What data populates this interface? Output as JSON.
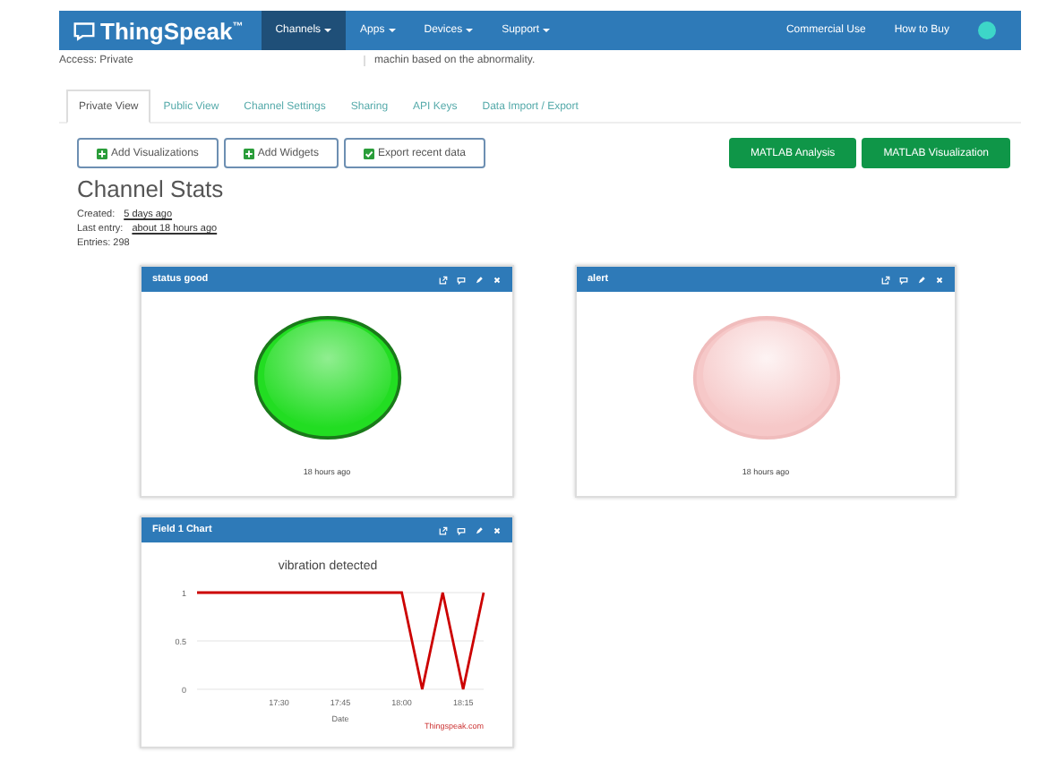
{
  "navbar": {
    "logo": "ThingSpeak$^{™}$",
    "menus": [
      {
        "label": "Channels",
        "selected": true
      },
      {
        "label": "Apps",
        "selected": false
      },
      {
        "label": "Devices",
        "selected": false
      },
      {
        "label": "Support",
        "selected": false
      }
    ],
    "links": [
      "Commercial Use",
      "How to Buy"
    ]
  },
  "info": {
    "access": "Access: Private",
    "description": "machin based on the abnormality."
  },
  "tabs": [
    {
      "label": "Private View",
      "selected": true
    },
    {
      "label": "Public View",
      "selected": false
    },
    {
      "label": "Channel Settings",
      "selected": false
    },
    {
      "label": "Sharing",
      "selected": false
    },
    {
      "label": "API Keys",
      "selected": false
    },
    {
      "label": "Data Import / Export",
      "selected": false
    }
  ],
  "actions": [
    {
      "label": "Add Visualizations",
      "kind": "add"
    },
    {
      "label": "Add Widgets",
      "kind": "add"
    },
    {
      "label": "Export recent data",
      "kind": "export"
    }
  ],
  "matlab_buttons": [
    "MATLAB Analysis",
    "MATLAB Visualization"
  ],
  "stats": {
    "title": "Channel Stats",
    "rows": [
      {
        "label": "Created:",
        "value": "5 days ago"
      },
      {
        "label": "Last entry:",
        "value": "about 18 hours ago"
      },
      {
        "label": "Entries: 298"
      }
    ]
  },
  "widgets": [
    {
      "kind": "lamp",
      "title": "status good",
      "on": true,
      "color": "#22dd22",
      "caption": "18 hours ago"
    },
    {
      "kind": "lamp",
      "title": "alert",
      "on": false,
      "color": "#f6c8c8",
      "caption": "18 hours ago"
    },
    {
      "kind": "chart",
      "title": "Field 1 Chart",
      "credit": "Thingspeak.com",
      "chart_data": {
        "type": "line",
        "title": "vibration detected",
        "xlabel": "Date",
        "categories": [
          null,
          null,
          null,
          null,
          "17:30",
          null,
          null,
          "17:45",
          null,
          null,
          "18:00",
          null,
          null,
          "18:15",
          null
        ],
        "series": [
          {
            "color": "#cc0000",
            "values": [
              1,
              1,
              1,
              1,
              1,
              1,
              1,
              1,
              1,
              1,
              1,
              0,
              1,
              0,
              1
            ]
          }
        ],
        "ylim": [
          0,
          1
        ],
        "yticks": [
          0,
          0.5,
          1
        ]
      }
    }
  ]
}
